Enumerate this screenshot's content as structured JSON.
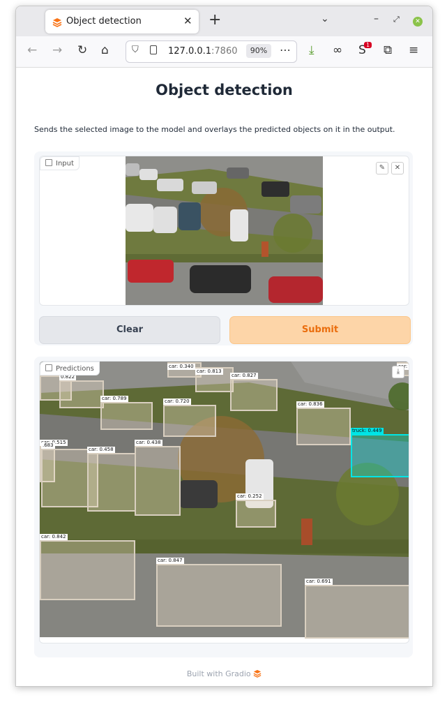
{
  "browser": {
    "tab_title": "Object detection",
    "url_host": "127.0.0.1",
    "url_port": ":7860",
    "zoom": "90%",
    "new_tab_symbol": "+",
    "notification_count": "1"
  },
  "page": {
    "title": "Object detection",
    "description": "Sends the selected image to the model and overlays the predicted objects on it in the output.",
    "input_label": "Input",
    "clear_label": "Clear",
    "submit_label": "Submit",
    "output_label": "Predictions",
    "footer_text": "Built with Gradio"
  },
  "detections": [
    {
      "label": "car: 0.340",
      "type": "car"
    },
    {
      "label": "car: 0.813",
      "type": "car"
    },
    {
      "label": "car: 0.796",
      "type": "car"
    },
    {
      "label": "0.822",
      "type": "car"
    },
    {
      "label": "car: 0.827",
      "type": "car"
    },
    {
      "label": "car: 0.425",
      "type": "car"
    },
    {
      "label": "car: 0.789",
      "type": "car"
    },
    {
      "label": "car: 0.720",
      "type": "car"
    },
    {
      "label": "car: 0.836",
      "type": "car"
    },
    {
      "label": "truck: 0.449",
      "type": "truck"
    },
    {
      "label": "car: 0.515",
      "type": "car"
    },
    {
      "label": ".683",
      "type": "car"
    },
    {
      "label": "car: 0.458",
      "type": "car"
    },
    {
      "label": "car: 0.438",
      "type": "car"
    },
    {
      "label": "car: 0.252",
      "type": "car"
    },
    {
      "label": "car: 0.842",
      "type": "car"
    },
    {
      "label": "car: 0.847",
      "type": "car"
    },
    {
      "label": "car: 0.691",
      "type": "car"
    }
  ],
  "colors": {
    "submit_bg": "#fdd5a8",
    "submit_text": "#ea6d0d",
    "clear_bg": "#e5e7eb",
    "truck_box": "#00e5e5",
    "car_box": "#d9cfc0"
  }
}
